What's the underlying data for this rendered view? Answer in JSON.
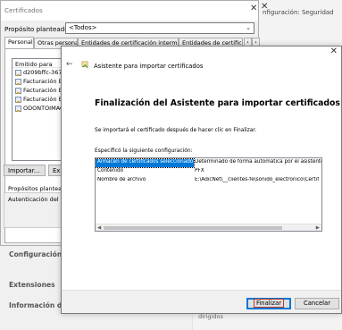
{
  "background": {
    "title": "nfiguración: Seguridad",
    "nav": [
      "Configuración ava",
      "Extensiones",
      "Información de C"
    ],
    "right_text": "dirigidos"
  },
  "cert_window": {
    "title": "Certificados",
    "purpose_label": "Propósito planteado:",
    "purpose_value": "<Todos>",
    "tabs": [
      "Personal",
      "Otras personas",
      "Entidades de certificación intermedias",
      "Entidades de certificación"
    ],
    "list_header": "Emitido para",
    "list_items": [
      "d209bffc-367c-",
      "Facturación Elec",
      "Facturación Elec",
      "Facturación Elec",
      "ODONTOIMAGE"
    ],
    "import_button": "Importar...",
    "export_button": "Exp",
    "purposes_label": "Propósitos planteado",
    "auth_label": "Autenticación del clien"
  },
  "wizard": {
    "header_title": "Asistente para importar certificados",
    "heading": "Finalización del Asistente para importar certificados",
    "description": "Se importará el certificado después de hacer clic en Finalizar.",
    "config_label": "Especificó la siguiente configuración:",
    "config_rows": [
      {
        "key": "Almacén de certificados seleccionado",
        "value": "Determinado de forma automática por el asistente"
      },
      {
        "key": "Contenido",
        "value": "PFX"
      },
      {
        "key": "Nombre de archivo",
        "value": "E:\\AdicNet\\__clientes-fe\\sonido_electronico\\Certif"
      }
    ],
    "finish_button": "Finalizar",
    "cancel_button": "Cancelar"
  }
}
